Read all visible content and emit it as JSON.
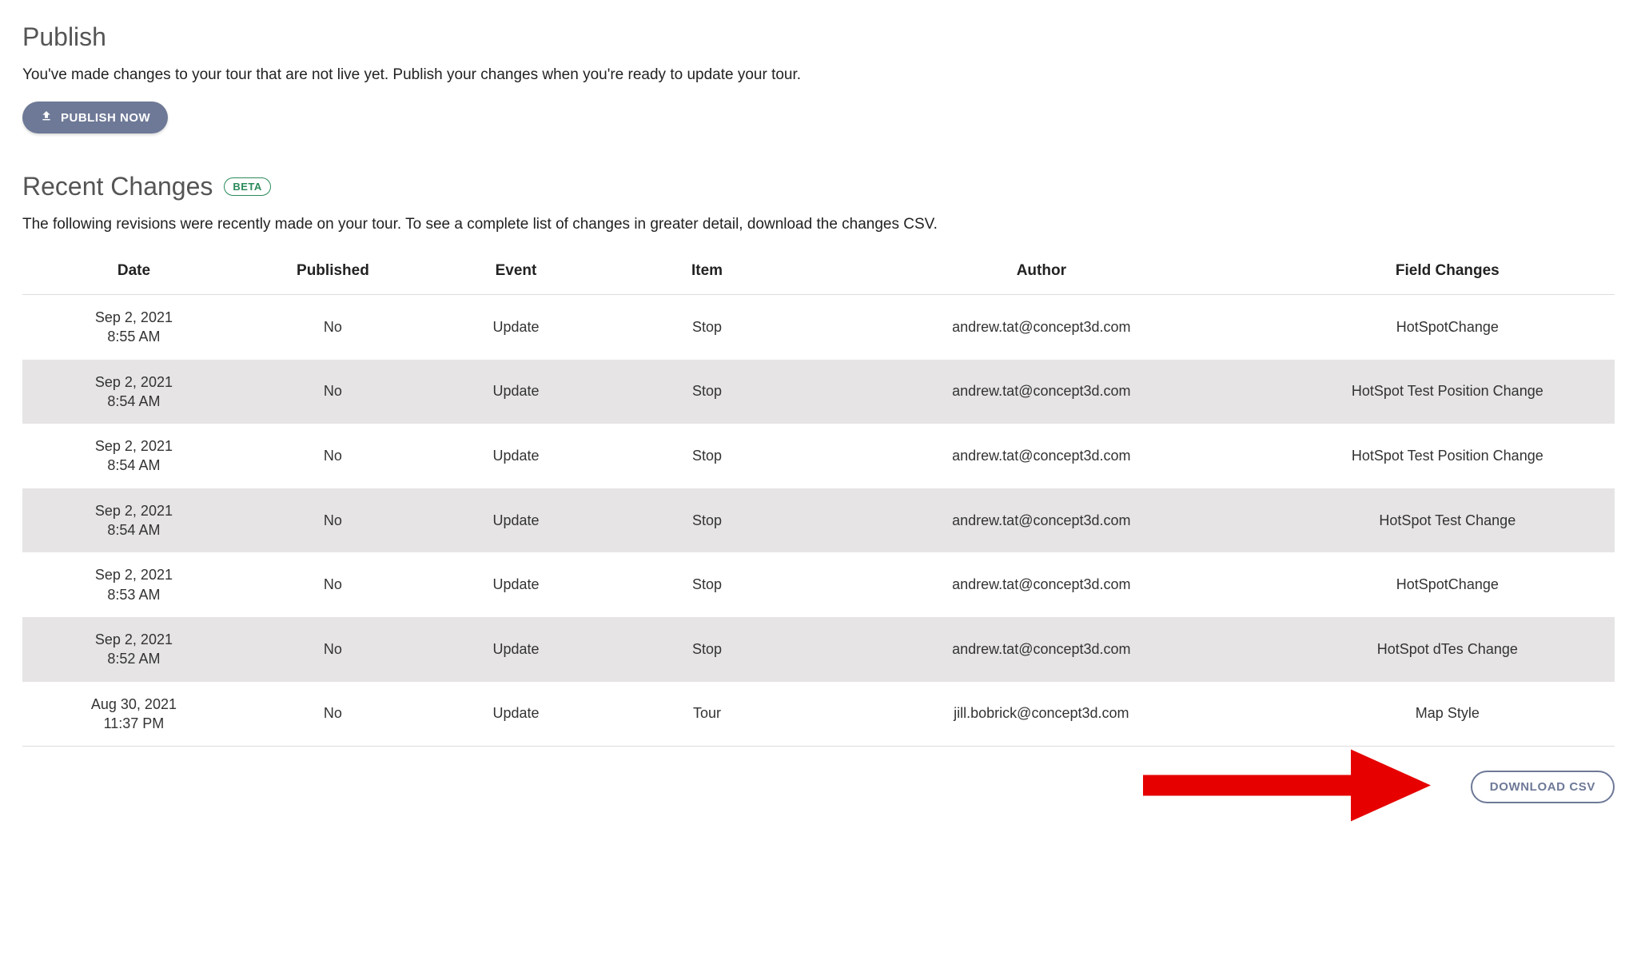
{
  "publish": {
    "title": "Publish",
    "description": "You've made changes to your tour that are not live yet. Publish your changes when you're ready to update your tour.",
    "button_label": "PUBLISH NOW"
  },
  "recent": {
    "title": "Recent Changes",
    "badge": "BETA",
    "description": "The following revisions were recently made on your tour. To see a complete list of changes in greater detail, download the changes CSV."
  },
  "table": {
    "headers": {
      "date": "Date",
      "published": "Published",
      "event": "Event",
      "item": "Item",
      "author": "Author",
      "field_changes": "Field Changes"
    },
    "rows": [
      {
        "date_line1": "Sep 2, 2021",
        "date_line2": "8:55 AM",
        "published": "No",
        "event": "Update",
        "item": "Stop",
        "author": "andrew.tat@concept3d.com",
        "field_changes": "HotSpotChange"
      },
      {
        "date_line1": "Sep 2, 2021",
        "date_line2": "8:54 AM",
        "published": "No",
        "event": "Update",
        "item": "Stop",
        "author": "andrew.tat@concept3d.com",
        "field_changes": "HotSpot Test Position Change"
      },
      {
        "date_line1": "Sep 2, 2021",
        "date_line2": "8:54 AM",
        "published": "No",
        "event": "Update",
        "item": "Stop",
        "author": "andrew.tat@concept3d.com",
        "field_changes": "HotSpot Test Position Change"
      },
      {
        "date_line1": "Sep 2, 2021",
        "date_line2": "8:54 AM",
        "published": "No",
        "event": "Update",
        "item": "Stop",
        "author": "andrew.tat@concept3d.com",
        "field_changes": "HotSpot Test Change"
      },
      {
        "date_line1": "Sep 2, 2021",
        "date_line2": "8:53 AM",
        "published": "No",
        "event": "Update",
        "item": "Stop",
        "author": "andrew.tat@concept3d.com",
        "field_changes": "HotSpotChange"
      },
      {
        "date_line1": "Sep 2, 2021",
        "date_line2": "8:52 AM",
        "published": "No",
        "event": "Update",
        "item": "Stop",
        "author": "andrew.tat@concept3d.com",
        "field_changes": "HotSpot dTes Change"
      },
      {
        "date_line1": "Aug 30, 2021",
        "date_line2": "11:37 PM",
        "published": "No",
        "event": "Update",
        "item": "Tour",
        "author": "jill.bobrick@concept3d.com",
        "field_changes": "Map Style"
      }
    ]
  },
  "download_button": "DOWNLOAD CSV",
  "colors": {
    "primary_button": "#6e7997",
    "no_text": "#9a2a2a",
    "beta_border": "#2a8a5a",
    "annotation_arrow": "#e60000"
  }
}
